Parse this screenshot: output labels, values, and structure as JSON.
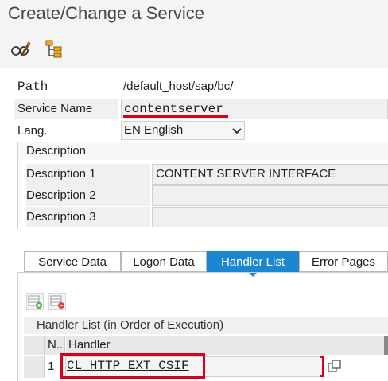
{
  "window": {
    "title": "Create/Change a Service"
  },
  "toolbar": {
    "buttons": [
      {
        "icon": "display-change-icon"
      },
      {
        "icon": "hierarchy-icon"
      }
    ]
  },
  "form": {
    "path_label": "Path",
    "path_value": "/default_host/sap/bc/",
    "service_name_label": "Service Name",
    "service_name_value": "contentserver",
    "lang_label": "Lang.",
    "lang_value": "EN English"
  },
  "description": {
    "header": "Description",
    "rows": [
      {
        "label": "Description 1",
        "value": "CONTENT SERVER INTERFACE"
      },
      {
        "label": "Description 2",
        "value": ""
      },
      {
        "label": "Description 3",
        "value": ""
      }
    ]
  },
  "tabs": [
    {
      "label": "Service Data",
      "active": false
    },
    {
      "label": "Logon Data",
      "active": false
    },
    {
      "label": "Handler List",
      "active": true
    },
    {
      "label": "Error Pages",
      "active": false
    }
  ],
  "handler_table": {
    "title": "Handler List (in Order of Execution)",
    "columns": [
      "N..",
      "Handler"
    ],
    "rows": [
      {
        "n": "1",
        "handler": "CL_HTTP_EXT_CSIF"
      }
    ]
  },
  "colors": {
    "active_tab": "#1d86d0",
    "highlight_red": "#d9001b"
  }
}
